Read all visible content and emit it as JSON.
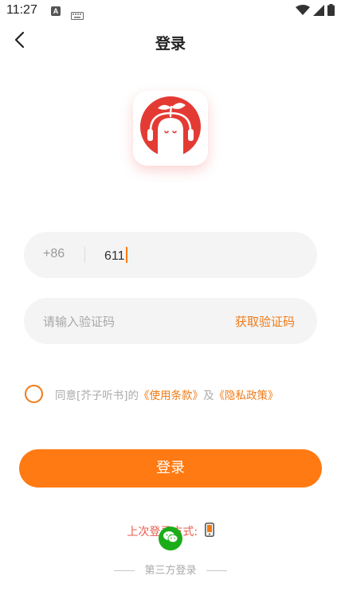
{
  "status_bar": {
    "time": "11:27",
    "icons": [
      "a-notification-icon",
      "keyboard-icon",
      "wifi-icon",
      "signal-icon",
      "battery-icon"
    ]
  },
  "header": {
    "back_icon": "chevron-left-icon",
    "title": "登录"
  },
  "logo": {
    "icon": "app-logo-icon",
    "colors": {
      "primary": "#e33b33",
      "leaf": "#e33b33"
    }
  },
  "phone": {
    "country_code": "+86",
    "value": "611"
  },
  "code": {
    "placeholder": "请输入验证码",
    "get_code_label": "获取验证码"
  },
  "agreement": {
    "prefix": "同意[芥子听书]的",
    "terms_link": "《使用条款》",
    "and": "及",
    "privacy_link": "《隐私政策》"
  },
  "login_button": {
    "label": "登录"
  },
  "last_login": {
    "text": "上次登录方式:",
    "icons": [
      "phone-icon",
      "wechat-icon"
    ]
  },
  "third_party": {
    "label": "第三方登录"
  },
  "colors": {
    "accent": "#ff7a12",
    "link": "#f07a16",
    "last_login_text": "#e85a4a",
    "wechat": "#1aad19"
  }
}
